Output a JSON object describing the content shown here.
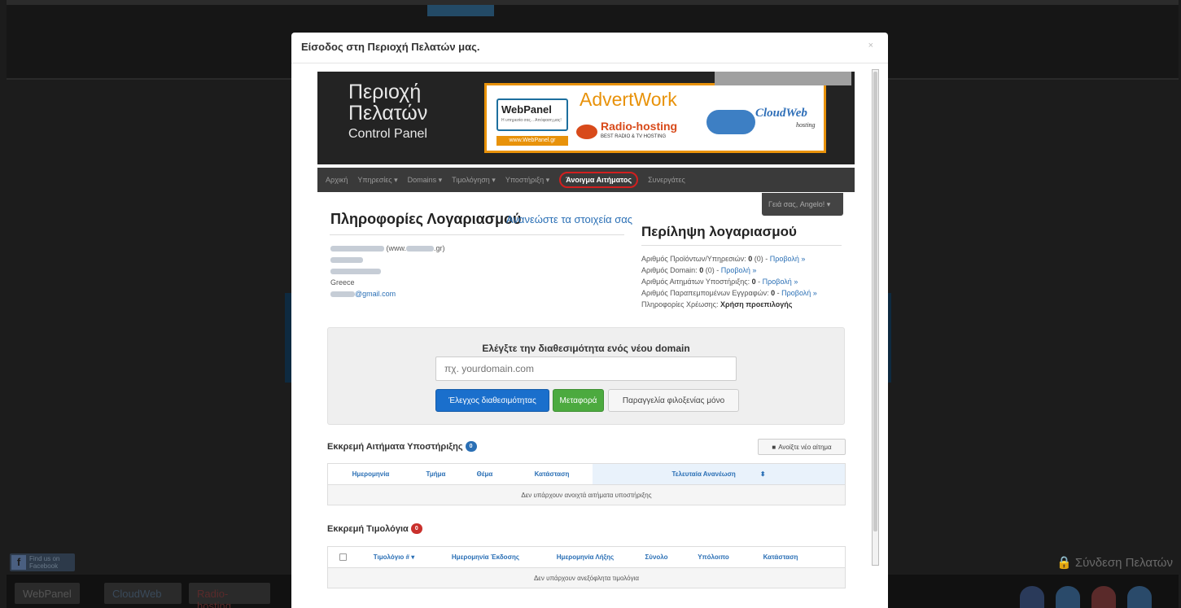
{
  "background": {
    "facebook": {
      "icon": "facebook-icon",
      "text_top": "Find us on",
      "text_bottom": "Facebook"
    },
    "login_link": "🔒 Σύνδεση Πελατών",
    "footer_logos": [
      "WebPanel",
      "CloudWeb",
      "Radio-hosting"
    ],
    "social_icons": [
      "facebook-icon",
      "twitter-icon",
      "google-plus-icon",
      "linkedin-icon"
    ]
  },
  "modal": {
    "title": "Είσοδος στη Περιοχή Πελατών μας.",
    "close": "×"
  },
  "banner": {
    "title_line1": "Περιοχή",
    "title_line2": "Πελατών",
    "subtitle": "Control Panel",
    "webpanel": {
      "name": "WebPanel",
      "tagline": "Η υπηρεσία σας... Απόφαση μας!",
      "url": "www.WebPanel.gr"
    },
    "advertwork": "AdvertWork",
    "radiohosting": {
      "name": "Radio-hosting",
      "tagline": "BEST RADIO & TV HOSTING"
    },
    "cloudweb": {
      "name": "CloudWeb",
      "tagline": "hosting"
    }
  },
  "nav": {
    "items": [
      {
        "label": "Αρχική",
        "dropdown": false
      },
      {
        "label": "Υπηρεσίες ▾",
        "dropdown": true
      },
      {
        "label": "Domains ▾",
        "dropdown": true
      },
      {
        "label": "Τιμολόγηση ▾",
        "dropdown": true
      },
      {
        "label": "Υποστήριξη ▾",
        "dropdown": true
      },
      {
        "label": "Άνοιγμα Αιτήματος",
        "active": true
      },
      {
        "label": "Συνεργάτες",
        "dropdown": false
      }
    ],
    "user_button": "Γειά σας, Angelo! ▾"
  },
  "account": {
    "title": "Πληροφορίες Λογαριασμού",
    "update_link": "Ανανεώστε τα στοιχεία σας",
    "website_suffix": "(www.",
    "website_domain_end": ".gr)",
    "country": "Greece",
    "email_suffix": "@gmail.com"
  },
  "summary": {
    "title": "Περίληψη λογαριασμού",
    "rows": [
      {
        "label": "Αριθμός Προϊόντων/Υπηρεσιών:",
        "value": "0",
        "extra": "(0) -",
        "link": "Προβολή »"
      },
      {
        "label": "Αριθμός Domain:",
        "value": "0",
        "extra": "(0) -",
        "link": "Προβολή »"
      },
      {
        "label": "Αριθμός Αιτημάτων Υποστήριξης:",
        "value": "0",
        "extra": "-",
        "link": "Προβολή »"
      },
      {
        "label": "Αριθμός Παραπεμπομένων Εγγραφών:",
        "value": "0",
        "extra": "-",
        "link": "Προβολή »"
      }
    ],
    "billing_label": "Πληροφορίες Χρέωσης:",
    "billing_value": "Χρήση προεπιλογής"
  },
  "domain_check": {
    "heading": "Ελέγξτε την διαθεσιμότητα ενός νέου domain",
    "placeholder": "πχ. yourdomain.com",
    "btn_check": "Έλεγχος διαθεσιμότητας",
    "btn_transfer": "Μεταφορά",
    "btn_hosting": "Παραγγελία φιλοξενίας μόνο"
  },
  "tickets": {
    "title": "Εκκρεμή Αιτήματα Υποστήριξης",
    "count": "0",
    "open_button": "Ανοίξτε νέο αίτημα",
    "columns": [
      "Ημερομηνία",
      "Τμήμα",
      "Θέμα",
      "Κατάσταση",
      "Τελευταία Ανανέωση"
    ],
    "empty": "Δεν υπάρχουν ανοιχτά αιτήματα υποστήριξης"
  },
  "invoices": {
    "title": "Εκκρεμή Τιμολόγια",
    "count": "0",
    "columns": [
      "Τιμολόγιο # ▾",
      "Ημερομηνία Έκδοσης",
      "Ημερομηνία Λήξης",
      "Σύνολο",
      "Υπόλοιπο",
      "Κατάσταση"
    ],
    "empty": "Δεν υπάρχουν ανεξόφλητα τιμολόγια"
  }
}
